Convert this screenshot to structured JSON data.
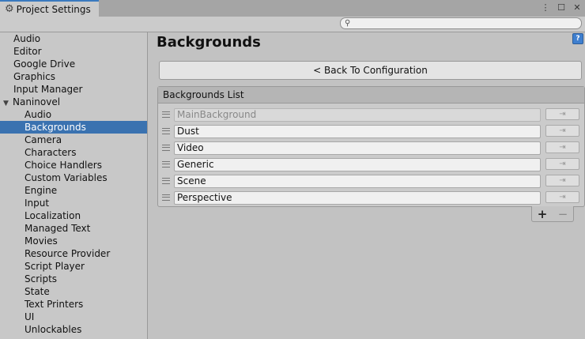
{
  "window": {
    "tab_title": "Project Settings",
    "tab_icon": "gear-icon",
    "controls": {
      "menu": "⋮",
      "maximize": "☐",
      "close": "✕"
    }
  },
  "search": {
    "placeholder": ""
  },
  "sidebar": {
    "items": [
      {
        "label": "Audio",
        "level": 0
      },
      {
        "label": "Editor",
        "level": 0
      },
      {
        "label": "Google Drive",
        "level": 0
      },
      {
        "label": "Graphics",
        "level": 0
      },
      {
        "label": "Input Manager",
        "level": 0
      },
      {
        "label": "Naninovel",
        "level": 0,
        "expanded": true
      },
      {
        "label": "Audio",
        "level": 1
      },
      {
        "label": "Backgrounds",
        "level": 1,
        "selected": true
      },
      {
        "label": "Camera",
        "level": 1
      },
      {
        "label": "Characters",
        "level": 1
      },
      {
        "label": "Choice Handlers",
        "level": 1
      },
      {
        "label": "Custom Variables",
        "level": 1
      },
      {
        "label": "Engine",
        "level": 1
      },
      {
        "label": "Input",
        "level": 1
      },
      {
        "label": "Localization",
        "level": 1
      },
      {
        "label": "Managed Text",
        "level": 1
      },
      {
        "label": "Movies",
        "level": 1
      },
      {
        "label": "Resource Provider",
        "level": 1
      },
      {
        "label": "Script Player",
        "level": 1
      },
      {
        "label": "Scripts",
        "level": 1
      },
      {
        "label": "State",
        "level": 1
      },
      {
        "label": "Text Printers",
        "level": 1
      },
      {
        "label": "UI",
        "level": 1
      },
      {
        "label": "Unlockables",
        "level": 1
      }
    ]
  },
  "main": {
    "title": "Backgrounds",
    "help_icon": "?",
    "back_button": "< Back To Configuration",
    "list": {
      "header": "Backgrounds List",
      "rows": [
        {
          "value": "MainBackground",
          "disabled": true
        },
        {
          "value": "Dust",
          "disabled": false
        },
        {
          "value": "Video",
          "disabled": false
        },
        {
          "value": "Generic",
          "disabled": false
        },
        {
          "value": "Scene",
          "disabled": false
        },
        {
          "value": "Perspective",
          "disabled": false
        }
      ],
      "row_button_icon": "⇥",
      "add_label": "+",
      "remove_label": "−"
    }
  },
  "colors": {
    "selection": "#3a72b0",
    "tab_accent": "#3a79bf",
    "background": "#c2c2c2"
  }
}
